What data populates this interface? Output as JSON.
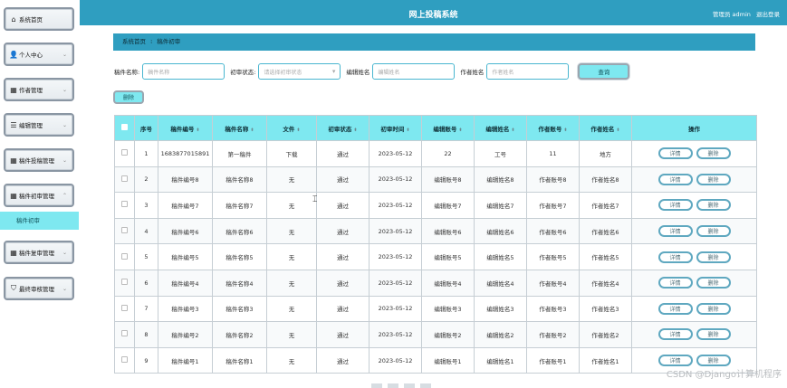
{
  "sidebar": {
    "items": [
      {
        "label": "系统首页",
        "icon": "home-icon",
        "glyph": "⌂",
        "chevron": ""
      },
      {
        "label": "个人中心",
        "icon": "user-icon",
        "glyph": "👤",
        "chevron": "⌄"
      },
      {
        "label": "作者管理",
        "icon": "grid-icon",
        "glyph": "▦",
        "chevron": "⌄"
      },
      {
        "label": "编辑管理",
        "icon": "list-icon",
        "glyph": "☰",
        "chevron": "⌄"
      },
      {
        "label": "稿件投稿管理",
        "icon": "grid-icon",
        "glyph": "▦",
        "chevron": "⌄"
      },
      {
        "label": "稿件初审管理",
        "icon": "grid-icon",
        "glyph": "▦",
        "chevron": "⌃"
      },
      {
        "label": "稿件复审管理",
        "icon": "grid-icon",
        "glyph": "▦",
        "chevron": "⌄"
      },
      {
        "label": "最终审核管理",
        "icon": "stamp-icon",
        "glyph": "⛉",
        "chevron": "⌄"
      }
    ],
    "active_sub": "稿件初审"
  },
  "header": {
    "title": "网上投稿系统",
    "user_label": "管理员 admin",
    "logout": "退出登录"
  },
  "breadcrumb": {
    "home": "系统首页",
    "separator": "⁝",
    "current": "稿件初审"
  },
  "search": {
    "fields": [
      {
        "label": "稿件名称:",
        "placeholder": "稿件名称"
      },
      {
        "label": "初审状态:",
        "placeholder": "请选择初审状态"
      },
      {
        "label": "编辑姓名",
        "placeholder": "编辑姓名"
      },
      {
        "label": "作者姓名",
        "placeholder": "作者姓名"
      }
    ],
    "button": "查询"
  },
  "toolbar": {
    "delete_label": "删除"
  },
  "table": {
    "headers": [
      "序号",
      "稿件编号",
      "稿件名称",
      "文件",
      "初审状态",
      "初审时间",
      "编辑账号",
      "编辑姓名",
      "作者账号",
      "作者姓名",
      "操作"
    ],
    "sort_glyph": "⬍",
    "rows": [
      [
        "1",
        "1683877015891",
        "第一稿件",
        "下载",
        "通过",
        "2023-05-12",
        "22",
        "工号",
        "11",
        "地方"
      ],
      [
        "2",
        "稿件编号8",
        "稿件名称8",
        "无",
        "通过",
        "2023-05-12",
        "编辑账号8",
        "编辑姓名8",
        "作者账号8",
        "作者姓名8"
      ],
      [
        "3",
        "稿件编号7",
        "稿件名称7",
        "无",
        "通过",
        "2023-05-12",
        "编辑账号7",
        "编辑姓名7",
        "作者账号7",
        "作者姓名7"
      ],
      [
        "4",
        "稿件编号6",
        "稿件名称6",
        "无",
        "通过",
        "2023-05-12",
        "编辑账号6",
        "编辑姓名6",
        "作者账号6",
        "作者姓名6"
      ],
      [
        "5",
        "稿件编号5",
        "稿件名称5",
        "无",
        "通过",
        "2023-05-12",
        "编辑账号5",
        "编辑姓名5",
        "作者账号5",
        "作者姓名5"
      ],
      [
        "6",
        "稿件编号4",
        "稿件名称4",
        "无",
        "通过",
        "2023-05-12",
        "编辑账号4",
        "编辑姓名4",
        "作者账号4",
        "作者姓名4"
      ],
      [
        "7",
        "稿件编号3",
        "稿件名称3",
        "无",
        "通过",
        "2023-05-12",
        "编辑账号3",
        "编辑姓名3",
        "作者账号3",
        "作者姓名3"
      ],
      [
        "8",
        "稿件编号2",
        "稿件名称2",
        "无",
        "通过",
        "2023-05-12",
        "编辑账号2",
        "编辑姓名2",
        "作者账号2",
        "作者姓名2"
      ],
      [
        "9",
        "稿件编号1",
        "稿件名称1",
        "无",
        "通过",
        "2023-05-12",
        "编辑账号1",
        "编辑姓名1",
        "作者账号1",
        "作者姓名1"
      ]
    ],
    "op_detail": "详情",
    "op_delete": "删除"
  },
  "watermark": "CSDN @Django计算机程序",
  "colors": {
    "primary": "#2f9ec0",
    "accent": "#7ee8f0",
    "download": "#2c9a3c"
  }
}
